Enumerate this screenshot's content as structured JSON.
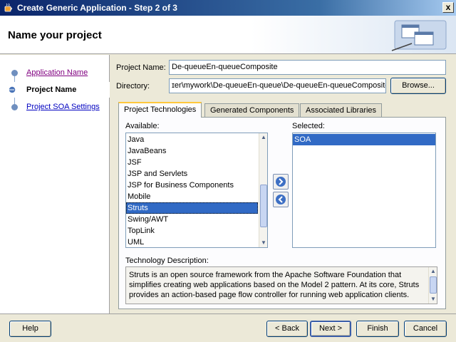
{
  "window": {
    "title": "Create Generic Application - Step 2 of 3",
    "close_label": "x"
  },
  "header": {
    "title": "Name your project"
  },
  "nav": {
    "items": [
      {
        "label": "Application Name"
      },
      {
        "label": "Project Name"
      },
      {
        "label": "Project SOA Settings"
      }
    ]
  },
  "form": {
    "project_name_label": "Project Name:",
    "project_name_value": "De-queueEn-queueComposite",
    "directory_label": "Directory:",
    "directory_value": "ɪer\\mywork\\De-queueEn-queue\\De-queueEn-queueComposite",
    "browse_label": "Browse..."
  },
  "tabs": [
    "Project Technologies",
    "Generated Components",
    "Associated Libraries"
  ],
  "technologies": {
    "available_label": "Available:",
    "selected_label": "Selected:",
    "available": [
      "Java",
      "JavaBeans",
      "JSF",
      "JSP and Servlets",
      "JSP for Business Components",
      "Mobile",
      "Struts",
      "Swing/AWT",
      "TopLink",
      "UML"
    ],
    "selected_available_item": "Struts",
    "selected": [
      "SOA"
    ],
    "add_icon": "arrow-right-icon",
    "remove_icon": "arrow-left-icon",
    "description_label": "Technology Description:",
    "description": "Struts is an open source framework from the Apache Software Foundation that simplifies creating web applications based on the Model 2 pattern. At its core, Struts provides an action-based page flow controller for running web application clients."
  },
  "buttons": {
    "help": "Help",
    "back": "< Back",
    "next": "Next >",
    "finish": "Finish",
    "cancel": "Cancel"
  },
  "colors": {
    "title_bar": "#0a246a",
    "selection": "#316ac5",
    "link": "#0000c0",
    "visited_link": "#800080",
    "tab_highlight": "#ffc83c"
  }
}
